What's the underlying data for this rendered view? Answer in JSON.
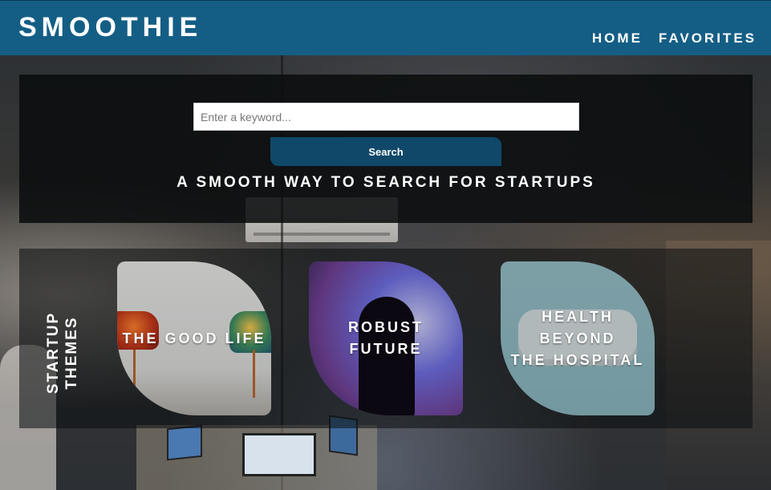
{
  "header": {
    "logo": "SMOOTHIE",
    "nav": [
      {
        "label": "HOME"
      },
      {
        "label": "FAVORITES"
      }
    ]
  },
  "search": {
    "placeholder": "Enter a keyword...",
    "value": "",
    "button_label": "Search",
    "tagline": "A SMOOTH WAY TO SEARCH FOR STARTUPS"
  },
  "themes": {
    "label": "STARTUP\nTHEMES",
    "cards": [
      {
        "title": "THE GOOD LIFE",
        "image_icon": "chairs-photo"
      },
      {
        "title": "ROBUST FUTURE",
        "image_icon": "silhouette-photo"
      },
      {
        "title": "HEALTH BEYOND\nTHE HOSPITAL",
        "image_icon": "face-mask-photo"
      }
    ]
  },
  "colors": {
    "header_bg": "#145e85",
    "button_bg": "#0f4868",
    "text": "#ffffff"
  }
}
